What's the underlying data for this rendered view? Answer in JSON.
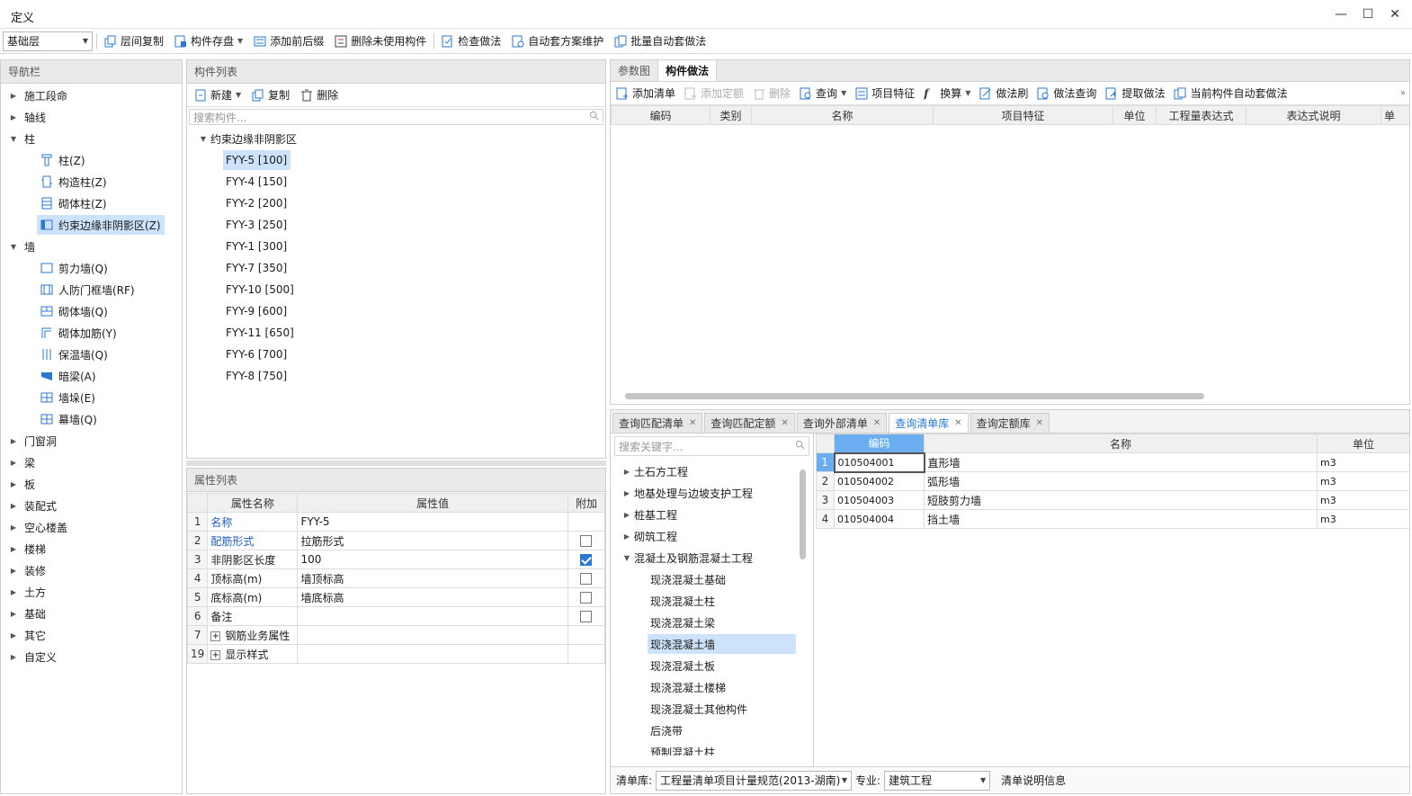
{
  "window": {
    "title": "定义",
    "controls": {
      "minimize": "—",
      "maximize": "☐",
      "close": "✕"
    }
  },
  "toolbar": {
    "floor": "基础层",
    "items": [
      "层间复制",
      "构件存盘",
      "添加前后缀",
      "删除未使用构件",
      "检查做法",
      "自动套方案维护",
      "批量自动套做法"
    ]
  },
  "nav": {
    "title": "导航栏",
    "items": [
      "施工段命",
      "轴线",
      "柱",
      "柱(Z)",
      "构造柱(Z)",
      "砌体柱(Z)",
      "约束边缘非阴影区(Z)",
      "墙",
      "剪力墙(Q)",
      "人防门框墙(RF)",
      "砌体墙(Q)",
      "砌体加筋(Y)",
      "保温墙(Q)",
      "暗梁(A)",
      "墙垛(E)",
      "幕墙(Q)",
      "门窗洞",
      "梁",
      "板",
      "装配式",
      "空心楼盖",
      "楼梯",
      "装修",
      "土方",
      "基础",
      "其它",
      "自定义"
    ]
  },
  "complist": {
    "title": "构件列表",
    "new_label": "新建",
    "copy_label": "复制",
    "delete_label": "删除",
    "search_placeholder": "搜索构件...",
    "group": "约束边缘非阴影区",
    "items": [
      "FYY-5 [100]",
      "FYY-4 [150]",
      "FYY-2 [200]",
      "FYY-3 [250]",
      "FYY-1 [300]",
      "FYY-7 [350]",
      "FYY-10 [500]",
      "FYY-9 [600]",
      "FYY-11 [650]",
      "FYY-6 [700]",
      "FYY-8 [750]"
    ]
  },
  "props": {
    "title": "属性列表",
    "headers": [
      "属性名称",
      "属性值",
      "附加"
    ],
    "rows": [
      {
        "num": "1",
        "name": "名称",
        "value": "FYY-5"
      },
      {
        "num": "2",
        "name": "配筋形式",
        "value": "拉筋形式"
      },
      {
        "num": "3",
        "name": "非阴影区长度",
        "value": "100"
      },
      {
        "num": "4",
        "name": "顶标高(m)",
        "value": "墙顶标高"
      },
      {
        "num": "5",
        "name": "底标高(m)",
        "value": "墙底标高"
      },
      {
        "num": "6",
        "name": "备注",
        "value": ""
      },
      {
        "num": "7",
        "name": "钢筋业务属性",
        "value": ""
      },
      {
        "num": "19",
        "name": "显示样式",
        "value": ""
      }
    ]
  },
  "rtop": {
    "tabs": [
      "参数图",
      "构件做法"
    ],
    "toolbar": [
      "添加清单",
      "添加定额",
      "删除",
      "查询",
      "项目特征",
      "换算",
      "做法刷",
      "做法查询",
      "提取做法",
      "当前构件自动套做法"
    ],
    "headers": [
      "编码",
      "类别",
      "名称",
      "项目特征",
      "单位",
      "工程量表达式",
      "表达式说明",
      "单"
    ]
  },
  "rbottom": {
    "tabs": [
      "查询匹配清单",
      "查询匹配定额",
      "查询外部清单",
      "查询清单库",
      "查询定额库"
    ],
    "search_placeholder": "搜索关键字...",
    "tree": [
      "土石方工程",
      "地基处理与边坡支护工程",
      "桩基工程",
      "砌筑工程",
      "混凝土及钢筋混凝土工程",
      "现浇混凝土基础",
      "现浇混凝土柱",
      "现浇混凝土梁",
      "现浇混凝土墙",
      "现浇混凝土板",
      "现浇混凝土楼梯",
      "现浇混凝土其他构件",
      "后浇带",
      "预制混凝土柱"
    ],
    "headers": [
      "编码",
      "名称",
      "单位"
    ],
    "rows": [
      {
        "num": "1",
        "code": "010504001",
        "name": "直形墙",
        "unit": "m3"
      },
      {
        "num": "2",
        "code": "010504002",
        "name": "弧形墙",
        "unit": "m3"
      },
      {
        "num": "3",
        "code": "010504003",
        "name": "短肢剪力墙",
        "unit": "m3"
      },
      {
        "num": "4",
        "code": "010504004",
        "name": "挡土墙",
        "unit": "m3"
      }
    ],
    "footer": {
      "lib_label": "清单库:",
      "lib_value": "工程量清单项目计量规范(2013-湖南)",
      "major_label": "专业:",
      "major_value": "建筑工程",
      "info": "清单说明信息"
    }
  }
}
